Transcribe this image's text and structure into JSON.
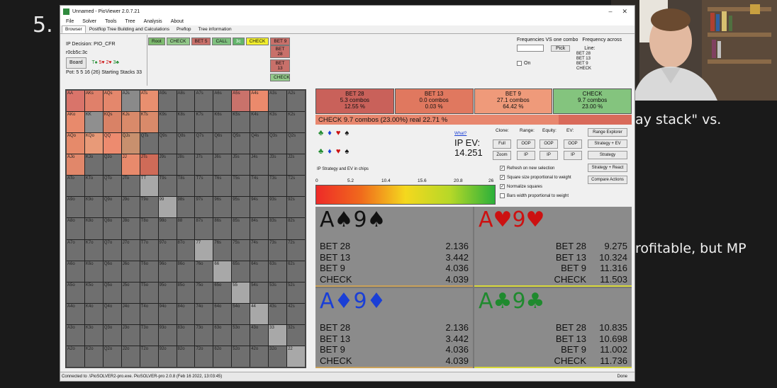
{
  "slide": {
    "number": "5.",
    "text_fragments": [
      "ay stack\" vs.",
      "rofitable, but MP"
    ]
  },
  "window": {
    "title": "Unnamed - PioViewer 2.0.7.21"
  },
  "menu": [
    "File",
    "Solver",
    "Tools",
    "Tree",
    "Analysis",
    "About"
  ],
  "tabs": [
    "Browser",
    "Postflop Tree Building and Calculations",
    "Preflop",
    "Tree information"
  ],
  "ipinfo": {
    "decision": "IP Decision:  PIO_CFR",
    "board_text": "r0cb5c:3c",
    "board_button": "Board",
    "cards": [
      {
        "text": "T♠",
        "suit": "c"
      },
      {
        "text": "5♥",
        "suit": "h"
      },
      {
        "text": "2♥",
        "suit": "h"
      },
      {
        "text": "3♣",
        "suit": "c"
      }
    ],
    "pot": "Pot: 5 5 16 (26) Starting Stacks 33"
  },
  "treenav": [
    {
      "label": "Root",
      "kind": "root"
    },
    {
      "label": "CHECK",
      "kind": "check"
    },
    {
      "label": "BET 5",
      "kind": "bet"
    },
    {
      "label": "CALL",
      "kind": "call"
    },
    {
      "label": "3c",
      "kind": "sel"
    },
    {
      "label": "CHECK",
      "kind": "hl"
    },
    {
      "label": "BET 9",
      "kind": "bet"
    }
  ],
  "bet_options": [
    {
      "label": "BET 28",
      "kind": "bet"
    },
    {
      "label": "BET 13",
      "kind": "bet"
    },
    {
      "label": "CHECK",
      "kind": "check"
    }
  ],
  "freqpanel": {
    "title": "Frequencies VS one combo",
    "title2": "Frequency across",
    "pick_label": "Pick",
    "on_label": "On",
    "line_label": "Line:",
    "lines": [
      "BET 28",
      "BET 13",
      "BET 9",
      "CHECK"
    ]
  },
  "grid": {
    "ranks": [
      "A",
      "K",
      "Q",
      "J",
      "T",
      "9",
      "8",
      "7",
      "6",
      "5",
      "4",
      "3",
      "2"
    ],
    "highlighted": {
      "AA": "#d9746a",
      "AKs": "#e0806a",
      "AQs": "#e4876c",
      "AJs": "#8a8a8a",
      "ATs": "#e98f6f",
      "AKo": "#e88a6c",
      "KK": "#8f8f8f",
      "KQs": "#d98266",
      "KJs": "#d98a6a",
      "KTs": "#d98a6a",
      "AQo": "#e68a6a",
      "KQo": "#e89a78",
      "QQ": "#ed8b6f",
      "QJs": "#c8906e",
      "AJo": "#e1876a",
      "JJ": "#e88a6c",
      "JTs": "#cf6b58",
      "A5s": "#c9726b",
      "A4s": "#eb8a6c",
      "TT": "#a8a8a8",
      "99": "#a8a8a8",
      "77": "#a8a8a8",
      "66": "#a8a8a8",
      "55": "#a8a8a8",
      "44": "#a8a8a8",
      "33": "#a8a8a8",
      "22": "#a8a8a8"
    }
  },
  "actions": [
    {
      "label": "BET 28",
      "combos": "5.3 combos",
      "pct": "12.55 %",
      "color": "#c9615a"
    },
    {
      "label": "BET 13",
      "combos": "0.0 combos",
      "pct": "0.03 %",
      "color": "#e0785f"
    },
    {
      "label": "BET 9",
      "combos": "27.1 combos",
      "pct": "64.42 %",
      "color": "#ef9a7a"
    },
    {
      "label": "CHECK",
      "combos": "9.7 combos",
      "pct": "23.00 %",
      "color": "#84c47e"
    }
  ],
  "selection_bar": "CHECK 9.7 combos (23.00%) real 22.71 %",
  "ev": {
    "what": "What?",
    "label": "IP EV:",
    "value": "14.251"
  },
  "tools": {
    "clone_label": "Clone:",
    "range_label": "Range:",
    "equity_label": "Equity:",
    "ev_label": "EV:",
    "full": "Full",
    "zoom": "Zoom",
    "oop": "OOP",
    "ip": "IP"
  },
  "checkboxes": [
    {
      "label": "Refresh on new selection",
      "checked": true
    },
    {
      "label": "Square size proportional to weight",
      "checked": true
    },
    {
      "label": "Normalize squares",
      "checked": true
    },
    {
      "label": "Bars width proportional to weight",
      "checked": false
    }
  ],
  "right_buttons": [
    "Range Explorer",
    "Strategy + EV",
    "Strategy",
    "Strategy + React",
    "Compare Actions"
  ],
  "strategy_label": "IP Strategy and EV in chips",
  "scale_ticks": [
    "0",
    "5.2",
    "10.4",
    "15.6",
    "20.8",
    "26"
  ],
  "hands": [
    {
      "rank1": "A",
      "suit1": "♠",
      "rank2": "9",
      "suit2": "♠",
      "suit": "s",
      "rows": [
        {
          "a": "BET 28",
          "v": "2.136"
        },
        {
          "a": "BET 13",
          "v": "3.442"
        },
        {
          "a": "BET 9",
          "v": "4.036"
        },
        {
          "a": "CHECK",
          "v": "4.039"
        }
      ],
      "edge": "#c9a15a"
    },
    {
      "rank1": "A",
      "suit1": "♥",
      "rank2": "9",
      "suit2": "♥",
      "suit": "h",
      "rows": [
        {
          "a": "BET 28",
          "v": "9.275"
        },
        {
          "a": "BET 13",
          "v": "10.324"
        },
        {
          "a": "BET 9",
          "v": "11.316"
        },
        {
          "a": "CHECK",
          "v": "11.503"
        }
      ],
      "edge": "#d8d83a"
    },
    {
      "rank1": "A",
      "suit1": "♦",
      "rank2": "9",
      "suit2": "♦",
      "suit": "d",
      "rows": [
        {
          "a": "BET 28",
          "v": "2.136"
        },
        {
          "a": "BET 13",
          "v": "3.442"
        },
        {
          "a": "BET 9",
          "v": "4.036"
        },
        {
          "a": "CHECK",
          "v": "4.039"
        }
      ],
      "edge": "#c9a15a"
    },
    {
      "rank1": "A",
      "suit1": "♣",
      "rank2": "9",
      "suit2": "♣",
      "suit": "c",
      "rows": [
        {
          "a": "BET 28",
          "v": "10.835"
        },
        {
          "a": "BET 13",
          "v": "10.698"
        },
        {
          "a": "BET 9",
          "v": "11.002"
        },
        {
          "a": "CHECK",
          "v": "11.736"
        }
      ],
      "edge": "#d8d83a"
    }
  ],
  "status": {
    "left": "Connected to .\\PioSOLVER2-pro.exe. PioSOLVER-pro 2.0.8 (Feb 16 2022, 13:03:45)",
    "right": "Done"
  },
  "colors": {
    "grid_default": "#6f6f6f",
    "pair_highlight": "#a8a8a8",
    "accent_green": "#2bb03a"
  }
}
